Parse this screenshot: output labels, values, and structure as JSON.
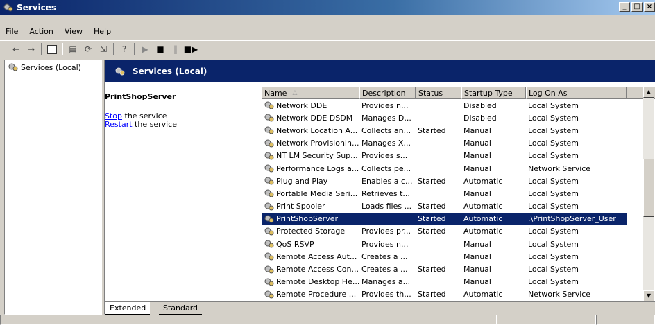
{
  "window": {
    "title": "Services"
  },
  "menu": [
    "File",
    "Action",
    "View",
    "Help"
  ],
  "tree": {
    "item": "Services (Local)"
  },
  "banner": {
    "title": "Services (Local)"
  },
  "detail": {
    "service_name": "PrintShopServer",
    "stop_link": "Stop",
    "stop_rest": " the service",
    "restart_link": "Restart",
    "restart_rest": " the service"
  },
  "columns": [
    "Name",
    "Description",
    "Status",
    "Startup Type",
    "Log On As"
  ],
  "rows": [
    {
      "name": "Network DDE",
      "description": "Provides n...",
      "status": "",
      "startup": "Disabled",
      "logon": "Local System"
    },
    {
      "name": "Network DDE DSDM",
      "description": "Manages D...",
      "status": "",
      "startup": "Disabled",
      "logon": "Local System"
    },
    {
      "name": "Network Location A...",
      "description": "Collects an...",
      "status": "Started",
      "startup": "Manual",
      "logon": "Local System"
    },
    {
      "name": "Network Provisionin...",
      "description": "Manages X...",
      "status": "",
      "startup": "Manual",
      "logon": "Local System"
    },
    {
      "name": "NT LM Security Sup...",
      "description": "Provides s...",
      "status": "",
      "startup": "Manual",
      "logon": "Local System"
    },
    {
      "name": "Performance Logs a...",
      "description": "Collects pe...",
      "status": "",
      "startup": "Manual",
      "logon": "Network Service"
    },
    {
      "name": "Plug and Play",
      "description": "Enables a c...",
      "status": "Started",
      "startup": "Automatic",
      "logon": "Local System"
    },
    {
      "name": "Portable Media Seri...",
      "description": "Retrieves t...",
      "status": "",
      "startup": "Manual",
      "logon": "Local System"
    },
    {
      "name": "Print Spooler",
      "description": "Loads files ...",
      "status": "Started",
      "startup": "Automatic",
      "logon": "Local System"
    },
    {
      "name": "PrintShopServer",
      "description": "",
      "status": "Started",
      "startup": "Automatic",
      "logon": ".\\PrintShopServer_User",
      "selected": true
    },
    {
      "name": "Protected Storage",
      "description": "Provides pr...",
      "status": "Started",
      "startup": "Automatic",
      "logon": "Local System"
    },
    {
      "name": "QoS RSVP",
      "description": "Provides n...",
      "status": "",
      "startup": "Manual",
      "logon": "Local System"
    },
    {
      "name": "Remote Access Aut...",
      "description": "Creates a ...",
      "status": "",
      "startup": "Manual",
      "logon": "Local System"
    },
    {
      "name": "Remote Access Con...",
      "description": "Creates a ...",
      "status": "Started",
      "startup": "Manual",
      "logon": "Local System"
    },
    {
      "name": "Remote Desktop He...",
      "description": "Manages a...",
      "status": "",
      "startup": "Manual",
      "logon": "Local System"
    },
    {
      "name": "Remote Procedure ...",
      "description": "Provides th...",
      "status": "Started",
      "startup": "Automatic",
      "logon": "Network Service"
    }
  ],
  "tabs": [
    "Extended",
    "Standard"
  ],
  "icons": {
    "app": "services-gear-icon",
    "back": "back-arrow-icon",
    "forward": "forward-arrow-icon",
    "console_tree": "show-hide-tree-icon",
    "properties": "properties-icon",
    "refresh": "refresh-icon",
    "export": "export-list-icon",
    "help": "help-icon",
    "start": "start-service-icon",
    "stop": "stop-service-icon",
    "pause": "pause-service-icon",
    "restart": "restart-service-icon"
  },
  "colors": {
    "titlebar": "#0a246a",
    "selection": "#0a246a",
    "link": "#0000ff"
  }
}
